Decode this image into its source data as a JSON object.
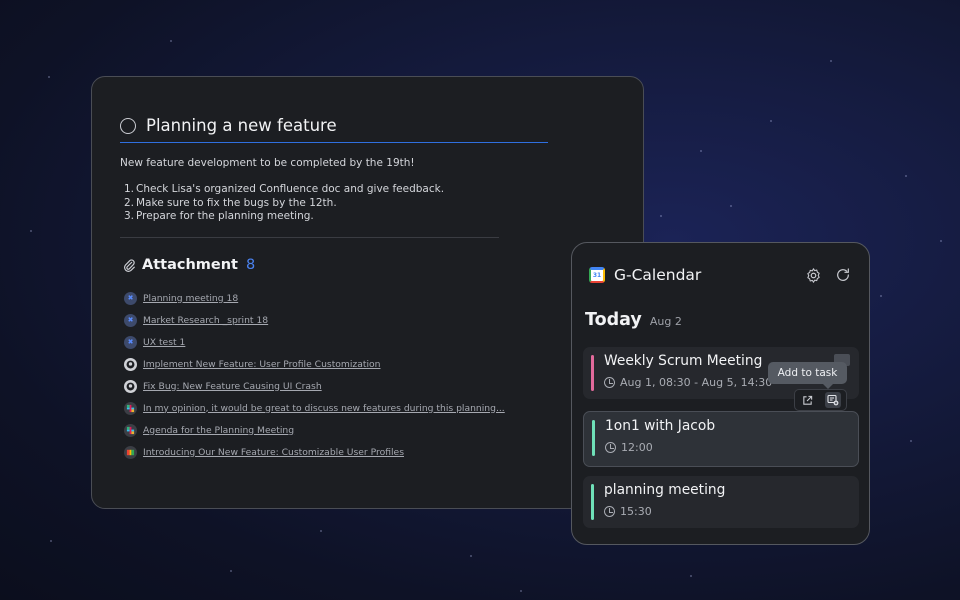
{
  "task": {
    "title": "Planning a new feature",
    "description": "New feature development to be completed by the 19th!",
    "list": [
      {
        "num": "1.",
        "text": "Check Lisa's organized Confluence doc and give feedback."
      },
      {
        "num": "2.",
        "text": "Make sure to fix the bugs by the 12th."
      },
      {
        "num": "3.",
        "text": "Prepare for the planning meeting."
      }
    ],
    "attachment_label": "Attachment",
    "attachment_count": "8",
    "attachments": [
      {
        "icon": "jira-icon",
        "text": "Planning meeting 18"
      },
      {
        "icon": "jira-icon",
        "text": "Market Research _sprint 18"
      },
      {
        "icon": "jira-icon",
        "text": "UX test 1"
      },
      {
        "icon": "github-icon",
        "text": "Implement New Feature: User Profile Customization"
      },
      {
        "icon": "github-icon",
        "text": "Fix Bug: New Feature Causing UI Crash"
      },
      {
        "icon": "slack-icon",
        "text": "In my opinion, it would be great to discuss new features during this planning..."
      },
      {
        "icon": "slack-icon",
        "text": "Agenda for the Planning Meeting"
      },
      {
        "icon": "doc-icon",
        "text": "Introducing Our New Feature: Customizable User Profiles"
      }
    ]
  },
  "calendar": {
    "title": "G-Calendar",
    "today_label": "Today",
    "today_date": "Aug 2",
    "events": [
      {
        "title": "Weekly Scrum Meeting",
        "time": "Aug 1, 08:30 - Aug 5, 14:30",
        "color": "#e26a9b"
      },
      {
        "title": "1on1 with Jacob",
        "time": "12:00",
        "color": "#6fe0b8"
      },
      {
        "title": "planning meeting",
        "time": "15:30",
        "color": "#6fe0b8"
      }
    ],
    "tooltip": "Add to task"
  },
  "colors": {
    "accent": "#2f6fe0",
    "attachment_count": "#4a82f0"
  }
}
